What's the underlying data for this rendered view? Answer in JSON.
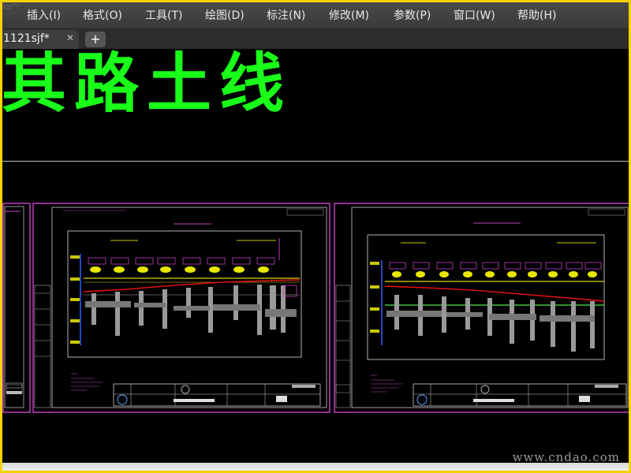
{
  "menubar": {
    "items": [
      "插入(I)",
      "格式(O)",
      "工具(T)",
      "绘图(D)",
      "标注(N)",
      "修改(M)",
      "参数(P)",
      "窗口(W)",
      "帮助(H)"
    ]
  },
  "tabs": {
    "active_label": "1121sjf*",
    "close_glyph": "✕",
    "add_glyph": "+"
  },
  "drawing": {
    "title_text": "其路土线",
    "text_color": "#19ff19",
    "sheet_border_color": "#c040c0",
    "profile_line_color": "#e01010",
    "ground_line_color": "#40c040"
  },
  "watermark": "www.cndao.com",
  "colors": {
    "frame": "#f3d400",
    "menubar": "#3f3f3f",
    "canvas": "#000000"
  }
}
